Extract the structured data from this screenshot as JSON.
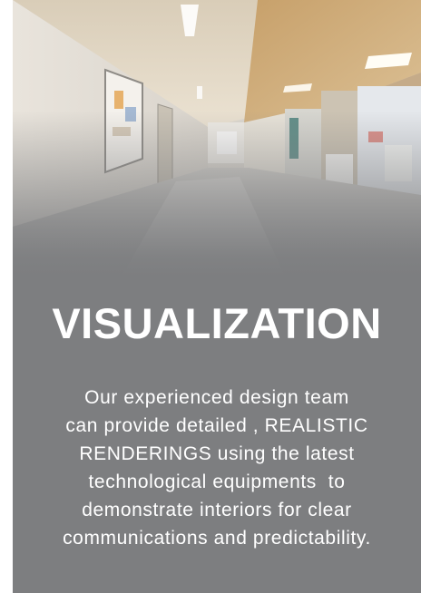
{
  "card": {
    "image": {
      "subject": "hospital-corridor-rendering"
    },
    "title": "VISUALIZATION",
    "description_lines": [
      "Our experienced design team",
      "can provide detailed , REALISTIC",
      "RENDERINGS using the latest",
      "technological equipments  to",
      "demonstrate interiors for clear",
      "communications and predictability."
    ]
  },
  "colors": {
    "panel": "#7d7e80",
    "text": "#ffffff"
  }
}
